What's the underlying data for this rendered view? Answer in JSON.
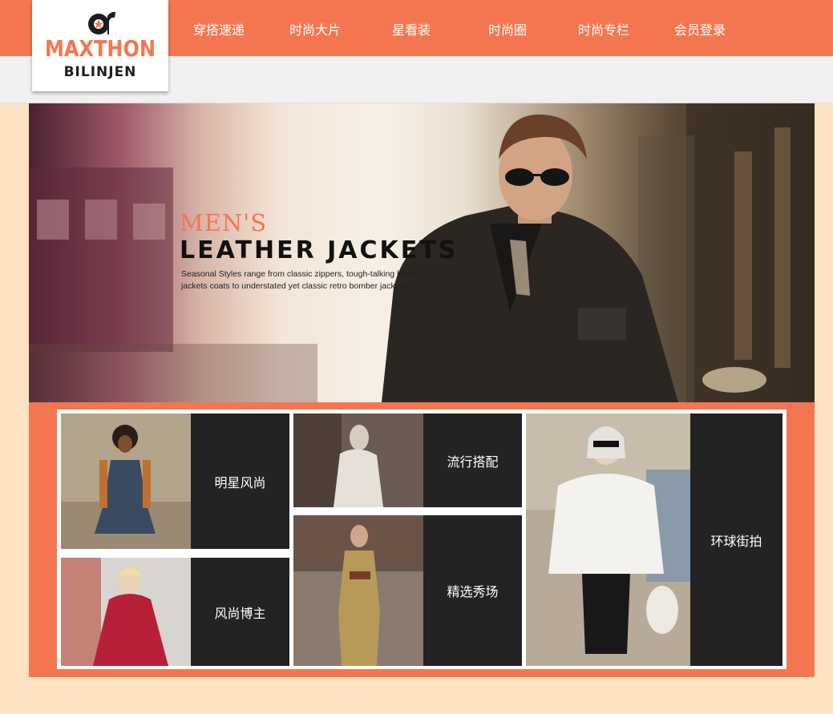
{
  "logo": {
    "main": "MAXTHON",
    "sub": "BILINJEN",
    "mark_icon": "ar-star-logo-icon"
  },
  "nav": {
    "items": [
      "穿搭速递",
      "时尚大片",
      "星看装",
      "时尚圈",
      "时尚专栏",
      "会员登录"
    ]
  },
  "banner": {
    "title_line1": "MEN'S",
    "title_line2": "LEATHER JACKETS",
    "description": "Seasonal Styles range from classic zippers, tough-talking biker jackets coats to understated yet classic retro bomber jackets."
  },
  "tiles": [
    {
      "label": "明星风尚"
    },
    {
      "label": "流行搭配"
    },
    {
      "label": "风尚博主"
    },
    {
      "label": "精选秀场"
    },
    {
      "label": "环球街拍"
    }
  ],
  "colors": {
    "accent": "#f47650",
    "page_bg": "#fde3c2",
    "tile_label_bg": "#232323"
  }
}
